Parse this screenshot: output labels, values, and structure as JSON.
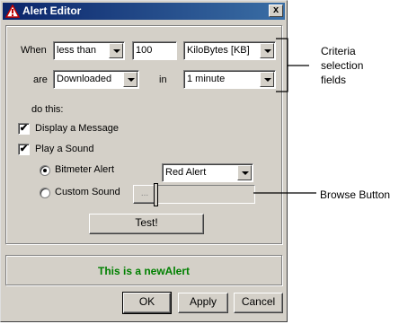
{
  "window": {
    "title": "Alert Editor",
    "close_glyph": "x"
  },
  "criteria": {
    "when_label": "When",
    "operator": "less than",
    "amount": "100",
    "unit": "KiloBytes [KB]",
    "are_label": "are",
    "direction": "Downloaded",
    "in_label": "in",
    "interval": "1 minute"
  },
  "actions": {
    "do_this_label": "do this:",
    "display_message": {
      "label": "Display a Message",
      "checked": true
    },
    "play_sound": {
      "label": "Play a Sound",
      "checked": true
    },
    "bitmeter_alert": {
      "label": "Bitmeter Alert",
      "selected": true
    },
    "bitmeter_sound": "Red Alert",
    "custom_sound": {
      "label": "Custom Sound",
      "selected": false
    },
    "browse_label": "...",
    "test_label": "Test!"
  },
  "preview": {
    "text": "This is a newAlert",
    "color": "#008000"
  },
  "footer": {
    "ok": "OK",
    "apply": "Apply",
    "cancel": "Cancel"
  },
  "annotations": {
    "criteria": [
      "Criteria",
      "selection",
      "fields"
    ],
    "browse": "Browse Button"
  },
  "colors": {
    "titlebar": "#0a246a",
    "face": "#d4d0c8",
    "check_glyph": "✔"
  }
}
